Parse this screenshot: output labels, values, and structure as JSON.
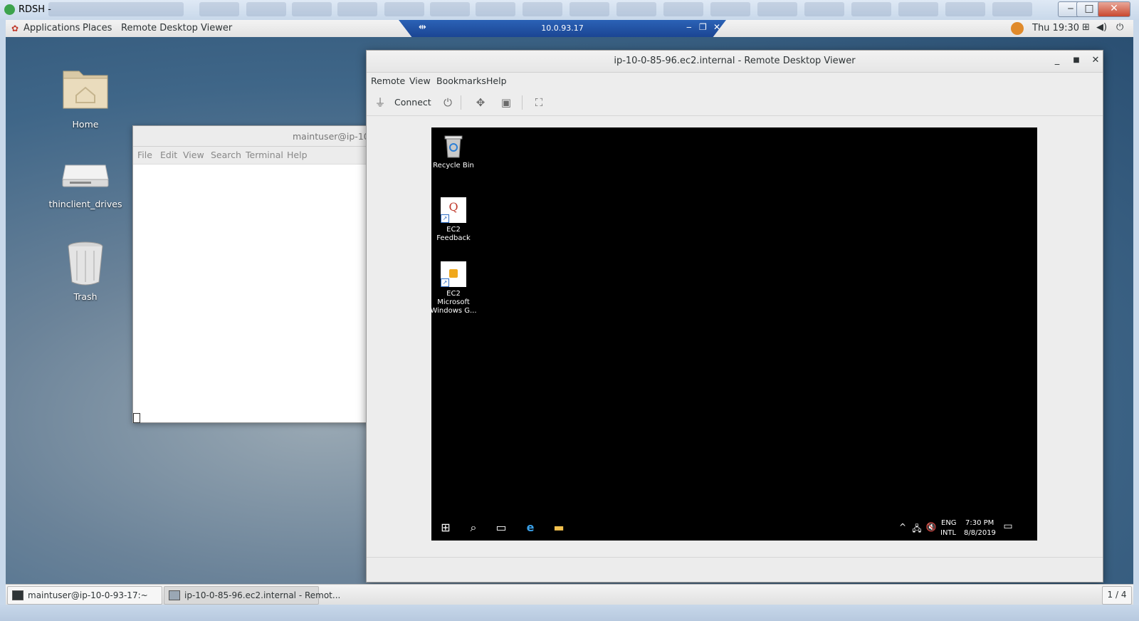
{
  "outer_window": {
    "title": "RDSH -",
    "minimize": "‒",
    "maximize": "□",
    "close": "✕"
  },
  "top_panel": {
    "applications": "Applications",
    "places": "Places",
    "app_name": "Remote Desktop Viewer",
    "clock": "Thu 19:30"
  },
  "rdp_hostbar": {
    "host": "10.0.93.17"
  },
  "desktop_icons": [
    {
      "label": "Home"
    },
    {
      "label": "thinclient_drives"
    },
    {
      "label": "Trash"
    }
  ],
  "terminal": {
    "title": "maintuser@ip-10-",
    "menu": [
      "File",
      "Edit",
      "View",
      "Search",
      "Terminal",
      "Help"
    ]
  },
  "rdv": {
    "title": "ip-10-0-85-96.ec2.internal - Remote Desktop Viewer",
    "menu": [
      "Remote",
      "View",
      "Bookmarks",
      "Help"
    ],
    "connect_label": "Connect"
  },
  "remote_desktop": {
    "icons": [
      {
        "label": "Recycle Bin"
      },
      {
        "label": "EC2 Feedback"
      },
      {
        "label": "EC2 Microsoft Windows G..."
      }
    ],
    "tray": {
      "lang_top": "ENG",
      "lang_bottom": "INTL",
      "time": "7:30 PM",
      "date": "8/8/2019"
    }
  },
  "taskbar": {
    "items": [
      {
        "label": "maintuser@ip-10-0-93-17:~"
      },
      {
        "label": "ip-10-0-85-96.ec2.internal - Remot..."
      }
    ],
    "workspace": "1 / 4"
  },
  "colors": {
    "rdp_bar": "#1b4593",
    "desktop_bg": "#3f6688",
    "remote_bg": "#000000"
  }
}
